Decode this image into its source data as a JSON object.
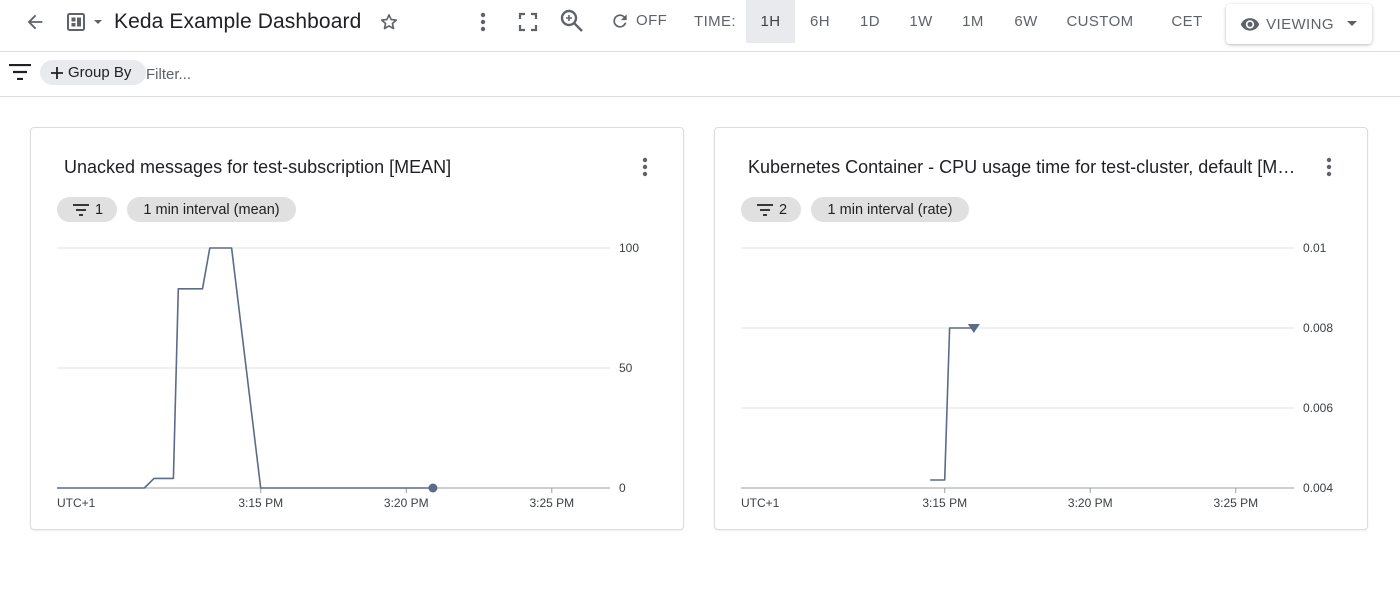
{
  "toolbar": {
    "title": "Keda Example Dashboard",
    "auto_refresh_label": "OFF",
    "time_label": "TIME:",
    "time_ranges": [
      "1H",
      "6H",
      "1D",
      "1W",
      "1M",
      "6W"
    ],
    "active_time_range": "1H",
    "custom_label": "CUSTOM",
    "timezone": "CET",
    "mode_label": "VIEWING"
  },
  "filterbar": {
    "group_by_label": "Group By",
    "filter_placeholder": "Filter..."
  },
  "widgets": [
    {
      "title": "Unacked messages for test-subscription [MEAN]",
      "filter_count": "1",
      "interval_label": "1 min interval (mean)"
    },
    {
      "title": "Kubernetes Container - CPU usage time for test-cluster, default [MEAN]",
      "filter_count": "2",
      "interval_label": "1 min interval (rate)"
    }
  ],
  "colors": {
    "series_line": "#5c6b8a",
    "grid": "#e0e0e0",
    "active_tab_bg": "#e8eaed"
  },
  "chart_data": [
    {
      "type": "line",
      "title": "Unacked messages for test-subscription [MEAN]",
      "x_timezone_label": "UTC+1",
      "x_ticks": [
        "3:15 PM",
        "3:20 PM",
        "3:25 PM"
      ],
      "y_ticks": [
        "100",
        "50",
        "0"
      ],
      "ylim": [
        0,
        100
      ],
      "xlim": [
        "3:08 PM",
        "3:27 PM"
      ],
      "grid": true,
      "series": [
        {
          "x": [
            "3:08 PM",
            "3:11 PM",
            "3:11:20 PM",
            "3:12 PM",
            "3:12:10 PM",
            "3:13 PM",
            "3:13:15 PM",
            "3:14 PM",
            "3:15 PM",
            "3:20:55 PM"
          ],
          "y": [
            0,
            0,
            4,
            4,
            83,
            83,
            100,
            100,
            0,
            0
          ],
          "end_marker": "dot"
        }
      ]
    },
    {
      "type": "line",
      "title": "Kubernetes Container - CPU usage time for test-cluster, default [MEAN]",
      "x_timezone_label": "UTC+1",
      "x_ticks": [
        "3:15 PM",
        "3:20 PM",
        "3:25 PM"
      ],
      "y_ticks": [
        "0.01",
        "0.008",
        "0.006",
        "0.004"
      ],
      "ylim": [
        0.004,
        0.01
      ],
      "xlim": [
        "3:08 PM",
        "3:27 PM"
      ],
      "grid": true,
      "series": [
        {
          "x": [
            "3:14:30 PM",
            "3:15 PM",
            "3:15:10 PM",
            "3:16 PM"
          ],
          "y": [
            0.0042,
            0.0042,
            0.008,
            0.008
          ],
          "end_marker": "triangle"
        }
      ]
    }
  ]
}
